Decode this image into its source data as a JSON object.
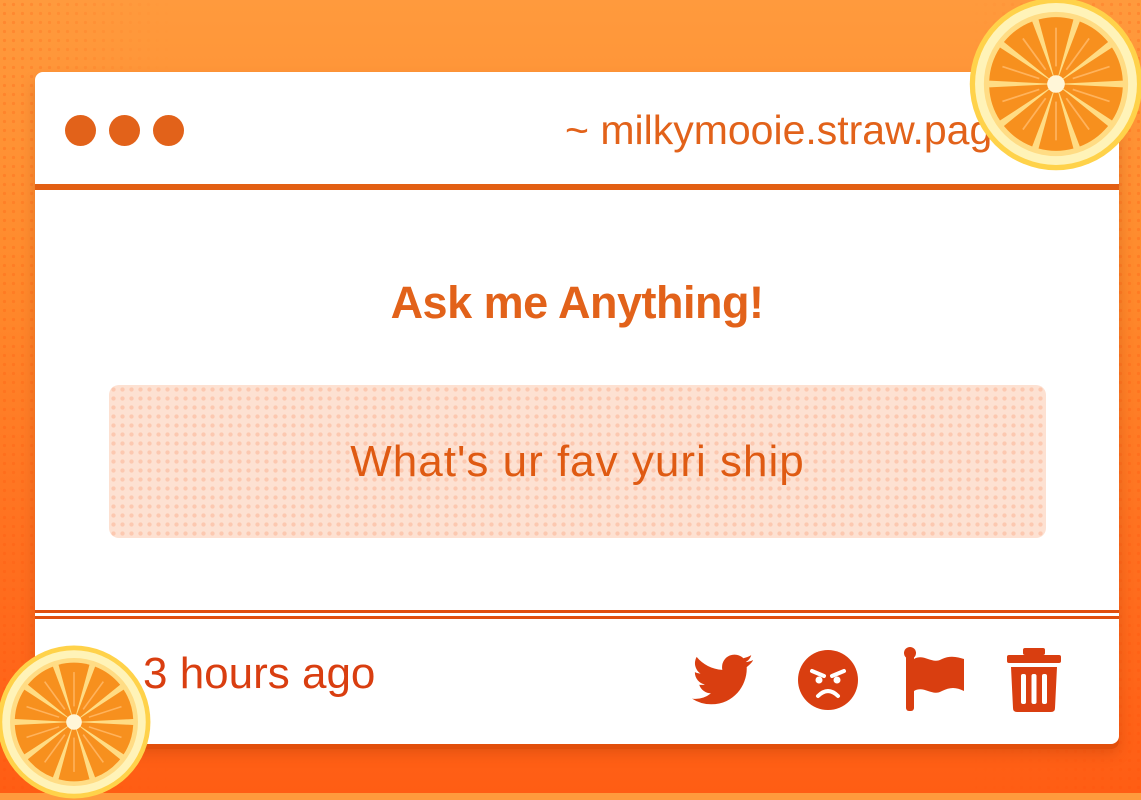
{
  "window": {
    "url": "~ milkymooie.straw.page"
  },
  "card": {
    "heading": "Ask me Anything!",
    "question": "What's ur fav yuri ship"
  },
  "footer": {
    "time": "3 hours ago",
    "actions": [
      {
        "icon": "twitter-icon",
        "label": "Share on Twitter"
      },
      {
        "icon": "angry-face-icon",
        "label": "React"
      },
      {
        "icon": "flag-icon",
        "label": "Report"
      },
      {
        "icon": "trash-icon",
        "label": "Delete"
      }
    ]
  },
  "decorations": [
    "orange-slice-icon",
    "orange-slice-icon"
  ],
  "colors": {
    "background": "#ff7d25",
    "accent": "#e2621a",
    "accent_dark": "#d93e10",
    "question_bg": "#fde1d2",
    "orange_rind": "#fff3b8",
    "orange_flesh": "#f7901e"
  }
}
